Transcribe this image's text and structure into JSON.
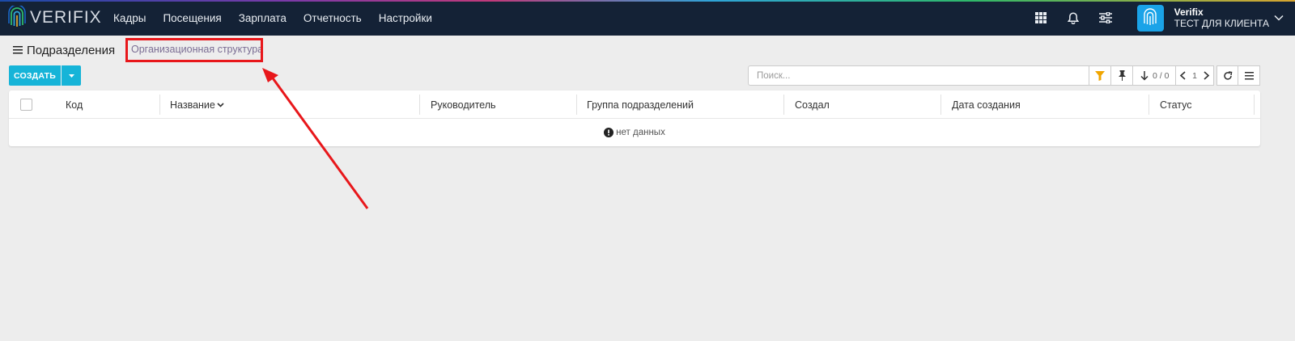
{
  "app": {
    "logo_text": "VERIFIX"
  },
  "nav": {
    "items": [
      {
        "label": "Кадры"
      },
      {
        "label": "Посещения"
      },
      {
        "label": "Зарплата"
      },
      {
        "label": "Отчетность"
      },
      {
        "label": "Настройки"
      }
    ]
  },
  "user": {
    "name": "Verifix",
    "company": "ТЕСТ ДЛЯ КЛИЕНТА"
  },
  "page": {
    "title": "Подразделения",
    "breadcrumb_link": "Организационная структура"
  },
  "toolbar": {
    "create_label": "СОЗДАТЬ",
    "search_placeholder": "Поиск...",
    "pager_count": "0 / 0",
    "page_number": "1"
  },
  "table": {
    "columns": [
      {
        "label": "Код"
      },
      {
        "label": "Название"
      },
      {
        "label": "Руководитель"
      },
      {
        "label": "Группа подразделений"
      },
      {
        "label": "Создал"
      },
      {
        "label": "Дата создания"
      },
      {
        "label": "Статус"
      }
    ],
    "empty_text": "нет данных"
  },
  "colors": {
    "navbar": "#142236",
    "accent": "#16b4d8",
    "highlight": "#e8171b",
    "link": "#7b6e94",
    "filter_icon": "#f0a500"
  }
}
